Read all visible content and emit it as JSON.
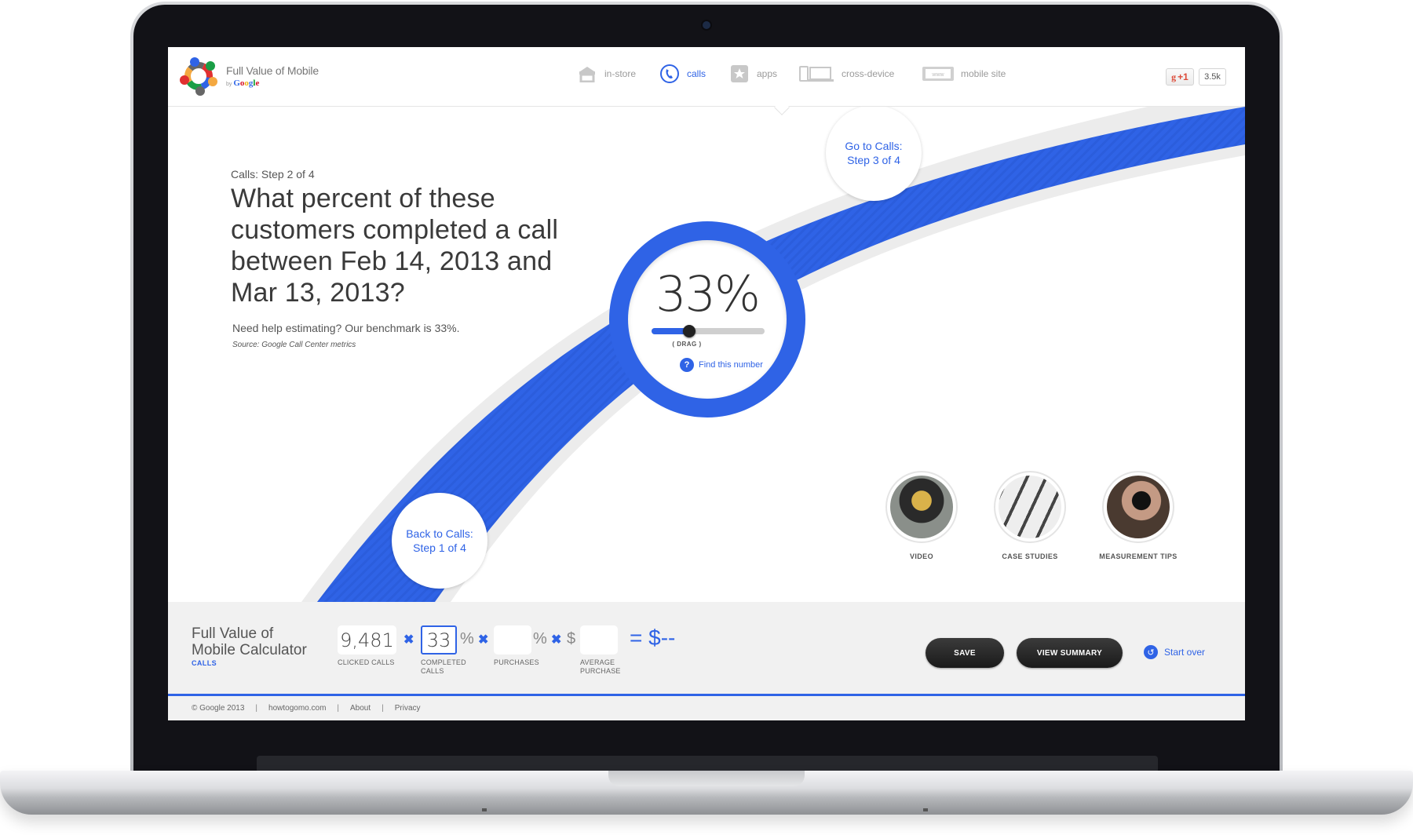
{
  "brand": {
    "title": "Full Value of Mobile",
    "by": "by",
    "google": "Google"
  },
  "nav": {
    "items": [
      {
        "label": "in-store",
        "icon": "store-icon",
        "active": false
      },
      {
        "label": "calls",
        "icon": "phone-icon",
        "active": true
      },
      {
        "label": "apps",
        "icon": "star-icon",
        "active": false
      },
      {
        "label": "cross-device",
        "icon": "devices-icon",
        "active": false
      },
      {
        "label": "mobile site",
        "icon": "www-icon",
        "active": false
      }
    ],
    "gplus_label": "+1",
    "gplus_count": "3.5k"
  },
  "main": {
    "step_label": "Calls: Step 2 of 4",
    "question": "What percent of these customers completed a call between Feb 14, 2013 and Mar 13, 2013?",
    "help": "Need help estimating? Our benchmark is 33%.",
    "source": "Source: Google Call Center metrics",
    "dial": {
      "value_label": "33%",
      "slider_value": 33,
      "drag_label": "( DRAG )",
      "find_label": "Find this number",
      "help_icon": "?"
    },
    "next_step": "Go to Calls: Step 3 of 4",
    "prev_step": "Back to Calls: Step 1 of 4",
    "resources": [
      {
        "label": "VIDEO"
      },
      {
        "label": "CASE STUDIES"
      },
      {
        "label": "MEASUREMENT TIPS"
      }
    ]
  },
  "calculator": {
    "title_line1": "Full Value of",
    "title_line2": "Mobile Calculator",
    "subtitle": "CALLS",
    "clicked_calls": {
      "value": "9,481",
      "label": "CLICKED CALLS"
    },
    "completed_calls": {
      "value": "33",
      "label_line1": "COMPLETED",
      "label_line2": "CALLS",
      "unit": "%"
    },
    "purchases": {
      "value": "",
      "label": "PURCHASES",
      "unit": "%"
    },
    "average_purchase": {
      "value": "",
      "label_line1": "AVERAGE",
      "label_line2": "PURCHASE",
      "unit": "$"
    },
    "multiply": "✖",
    "result": "= $--",
    "save_label": "SAVE",
    "summary_label": "VIEW SUMMARY",
    "start_over_label": "Start over"
  },
  "footer": {
    "copyright": "© Google 2013",
    "site": "howtogomo.com",
    "about": "About",
    "privacy": "Privacy",
    "separator": "|"
  },
  "colors": {
    "accent": "#2f63e6",
    "ribbon_edge": "#ececec",
    "button_dark": "#222222"
  }
}
